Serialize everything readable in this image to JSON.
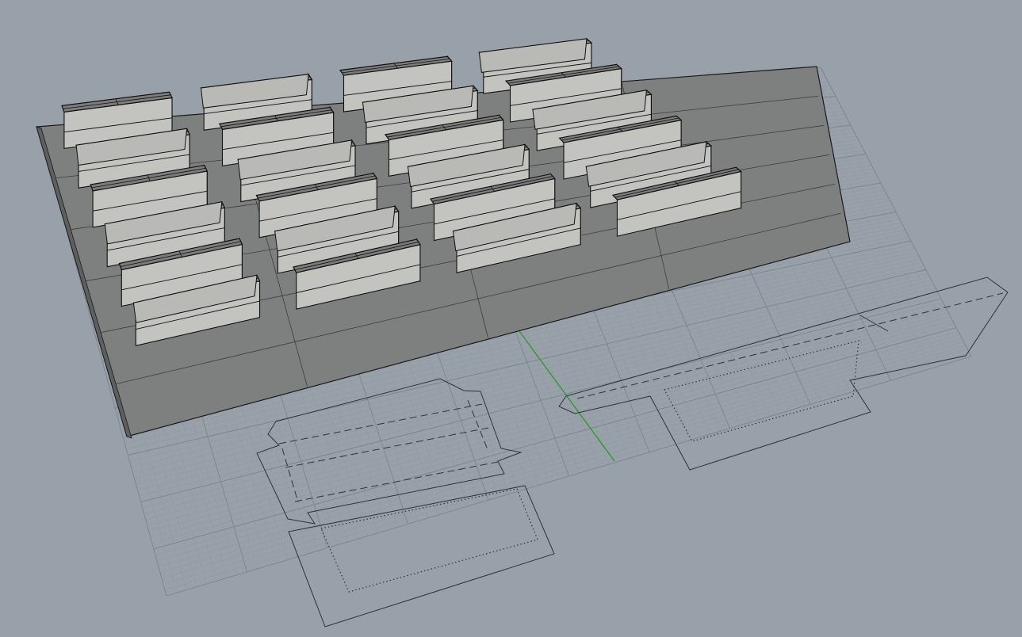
{
  "viewport": {
    "view": "perspective",
    "display_mode": "shaded",
    "background_color": "#98a0a9",
    "grid_minor_color": "#8f97a0",
    "grid_major_color": "#7b838c",
    "y_axis_color": "#2f9a2f",
    "box_top_color": "#7c7c7c",
    "box_front_color": "#c3c3c0",
    "box_side_color": "#6a6a6a",
    "base_plate_color": "#7e8080"
  },
  "scene": {
    "object": "box-array",
    "columns": 4,
    "rows": 6,
    "flat_patterns": 2
  }
}
